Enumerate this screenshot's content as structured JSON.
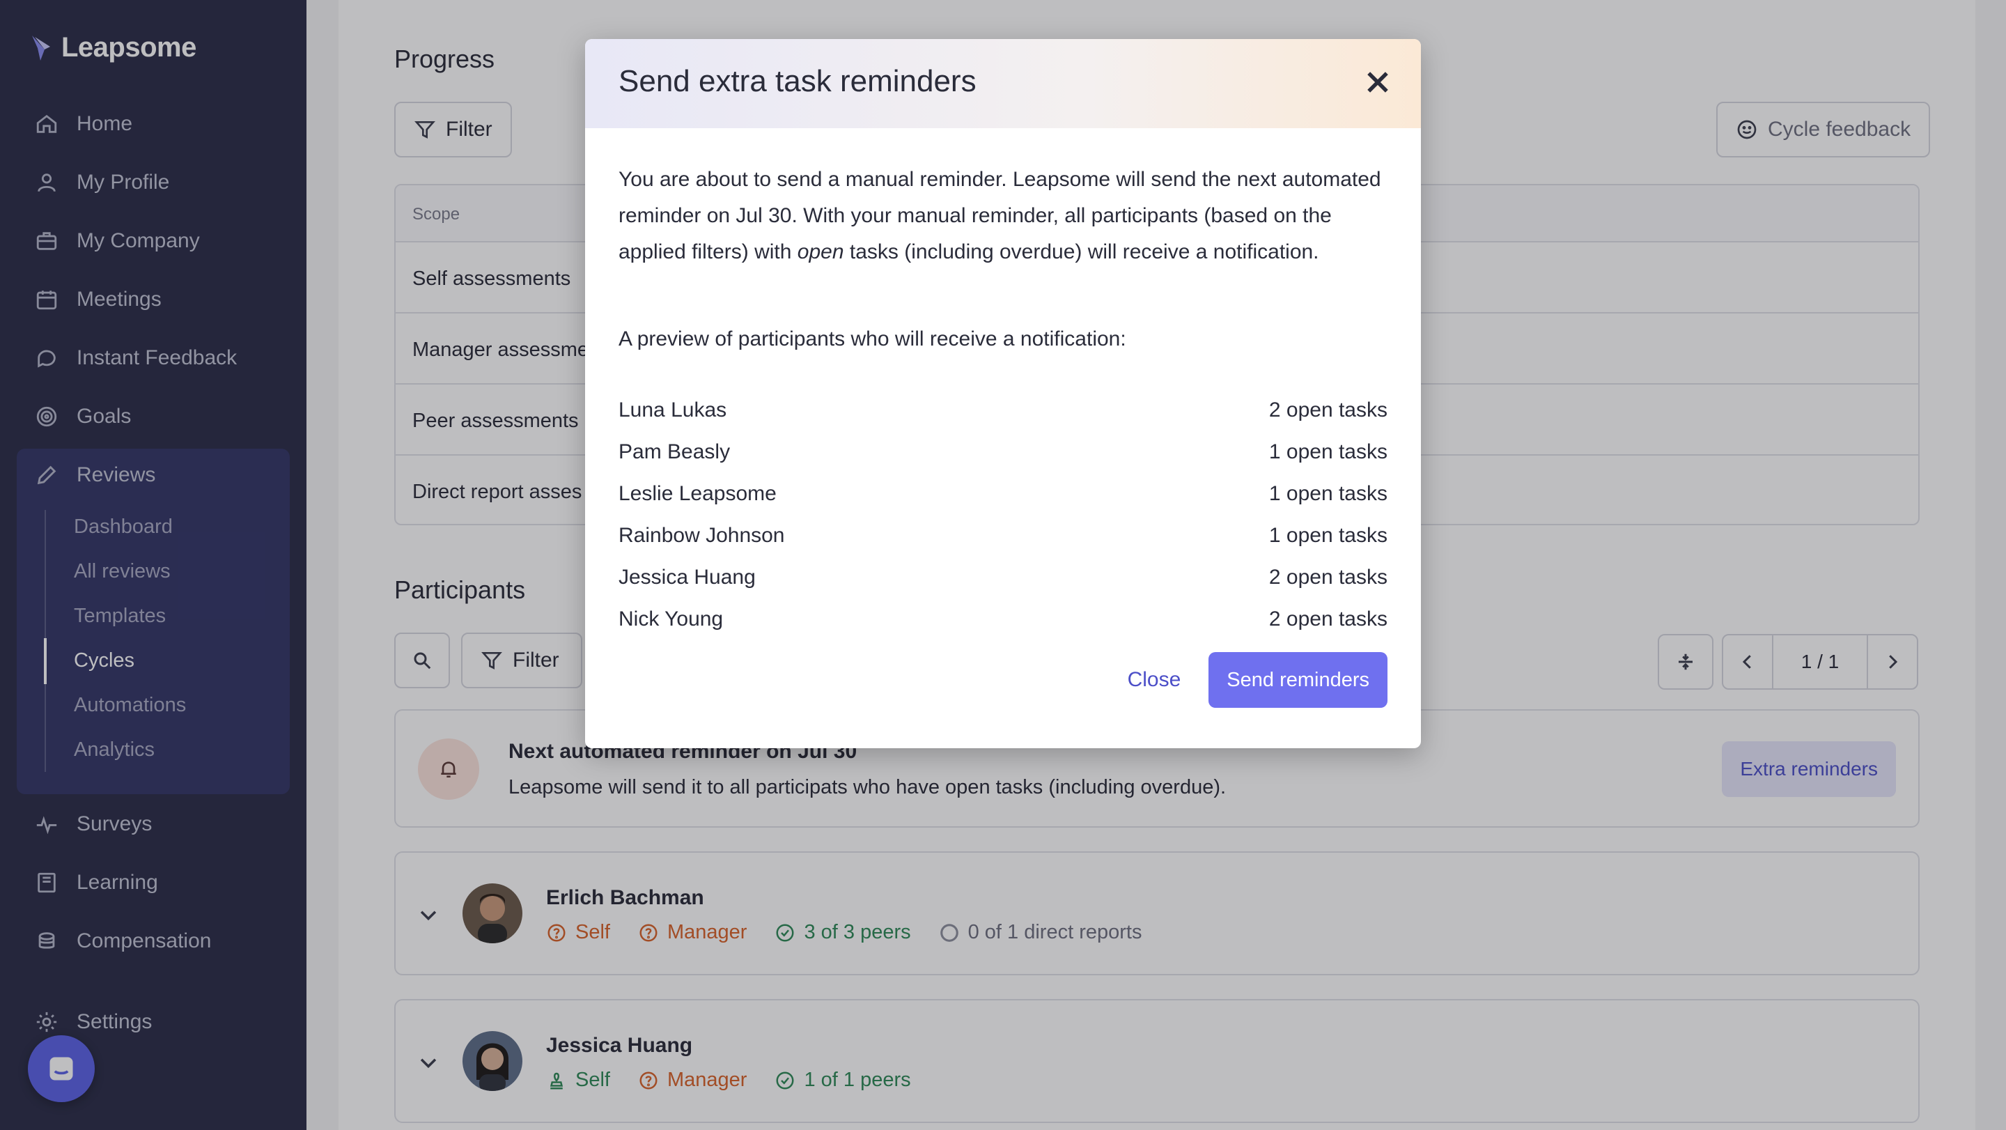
{
  "brand": {
    "name": "Leapsome"
  },
  "sidebar": {
    "items": [
      {
        "label": "Home",
        "icon": "home-icon"
      },
      {
        "label": "My Profile",
        "icon": "user-icon"
      },
      {
        "label": "My Company",
        "icon": "briefcase-icon"
      },
      {
        "label": "Meetings",
        "icon": "calendar-icon"
      },
      {
        "label": "Instant Feedback",
        "icon": "chat-icon"
      },
      {
        "label": "Goals",
        "icon": "target-icon"
      },
      {
        "label": "Reviews",
        "icon": "pencil-icon"
      },
      {
        "label": "Surveys",
        "icon": "pulse-icon"
      },
      {
        "label": "Learning",
        "icon": "book-icon"
      },
      {
        "label": "Compensation",
        "icon": "coins-icon"
      },
      {
        "label": "Settings",
        "icon": "gear-icon"
      }
    ],
    "reviews_sub": [
      "Dashboard",
      "All reviews",
      "Templates",
      "Cycles",
      "Automations",
      "Analytics"
    ],
    "active_sub": "Cycles"
  },
  "progress": {
    "title": "Progress",
    "filter_label": "Filter",
    "cycle_feedback_label": "Cycle feedback",
    "table_header": "Scope",
    "rows": [
      "Self assessments",
      "Manager assessme",
      "Peer assessments",
      "Direct report asses"
    ]
  },
  "participants": {
    "title": "Participants",
    "filter_label": "Filter",
    "pager": "1 / 1"
  },
  "reminder": {
    "title": "Next automated reminder on Jul 30",
    "description": "Leapsome will send it to all participats who have open tasks (including overdue).",
    "extra_button": "Extra reminders"
  },
  "people": [
    {
      "name": "Erlich Bachman",
      "badges": [
        {
          "label": "Self",
          "status": "pending"
        },
        {
          "label": "Manager",
          "status": "pending"
        },
        {
          "label": "3 of 3 peers",
          "status": "done"
        },
        {
          "label": "0 of 1 direct reports",
          "status": "empty"
        }
      ]
    },
    {
      "name": "Jessica Huang",
      "badges": [
        {
          "label": "Self",
          "status": "signed"
        },
        {
          "label": "Manager",
          "status": "pending"
        },
        {
          "label": "1 of 1 peers",
          "status": "done"
        }
      ]
    }
  ],
  "modal": {
    "title": "Send extra task reminders",
    "body_part1": "You are about to send a manual reminder. Leapsome will send the next automated reminder on Jul 30. With your manual reminder, all participants (based on the applied filters) with ",
    "body_em": "open",
    "body_part2": " tasks (including overdue) will receive a notification.",
    "preview_title": "A preview of participants who will receive a notification:",
    "participants": [
      {
        "name": "Luna Lukas",
        "tasks": "2 open tasks"
      },
      {
        "name": "Pam Beasly",
        "tasks": "1 open tasks"
      },
      {
        "name": "Leslie Leapsome",
        "tasks": "1 open tasks"
      },
      {
        "name": "Rainbow Johnson",
        "tasks": "1 open tasks"
      },
      {
        "name": "Jessica Huang",
        "tasks": "2 open tasks"
      },
      {
        "name": "Nick Young",
        "tasks": "2 open tasks"
      }
    ],
    "close_label": "Close",
    "send_label": "Send reminders"
  },
  "colors": {
    "accent": "#6f70ef",
    "sidebar": "#2b2d48",
    "pending": "#d8632a",
    "done": "#2e8a58"
  }
}
